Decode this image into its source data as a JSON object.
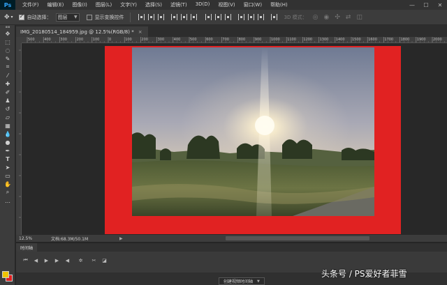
{
  "app": {
    "logo": "Ps",
    "menu": [
      "文件(F)",
      "编辑(E)",
      "图像(I)",
      "图层(L)",
      "文字(Y)",
      "选择(S)",
      "滤镜(T)",
      "3D(D)",
      "视图(V)",
      "窗口(W)",
      "帮助(H)"
    ]
  },
  "options_bar": {
    "auto_select_label": "自动选择：",
    "auto_select_checked": true,
    "target_value": "图层",
    "show_transform_label": "显示变换控件",
    "show_transform_checked": false,
    "mode_3d_label": "3D 模式："
  },
  "document": {
    "tab_title": "IMG_20180514_184959.jpg @ 12.5%(RGB/8) *",
    "close_glyph": "×"
  },
  "ruler": {
    "top_labels": [
      "500",
      "400",
      "300",
      "200",
      "100",
      "0",
      "100",
      "200",
      "300",
      "400",
      "500",
      "600",
      "700",
      "800",
      "900",
      "1000",
      "1100",
      "1200",
      "1300",
      "1400",
      "1500",
      "1600",
      "1700",
      "1800",
      "1900",
      "2000"
    ]
  },
  "status": {
    "zoom": "12.5%",
    "doc_size": "文档:68.3M/50.1M"
  },
  "timeline": {
    "tab_label": "时间轴",
    "create_button": "创建视频时间轴"
  },
  "watermark": "头条号 / PS爱好者菲雪",
  "colors": {
    "foreground": "#f0c300",
    "background": "#e01f1f",
    "canvas_frame": "#e12222"
  }
}
